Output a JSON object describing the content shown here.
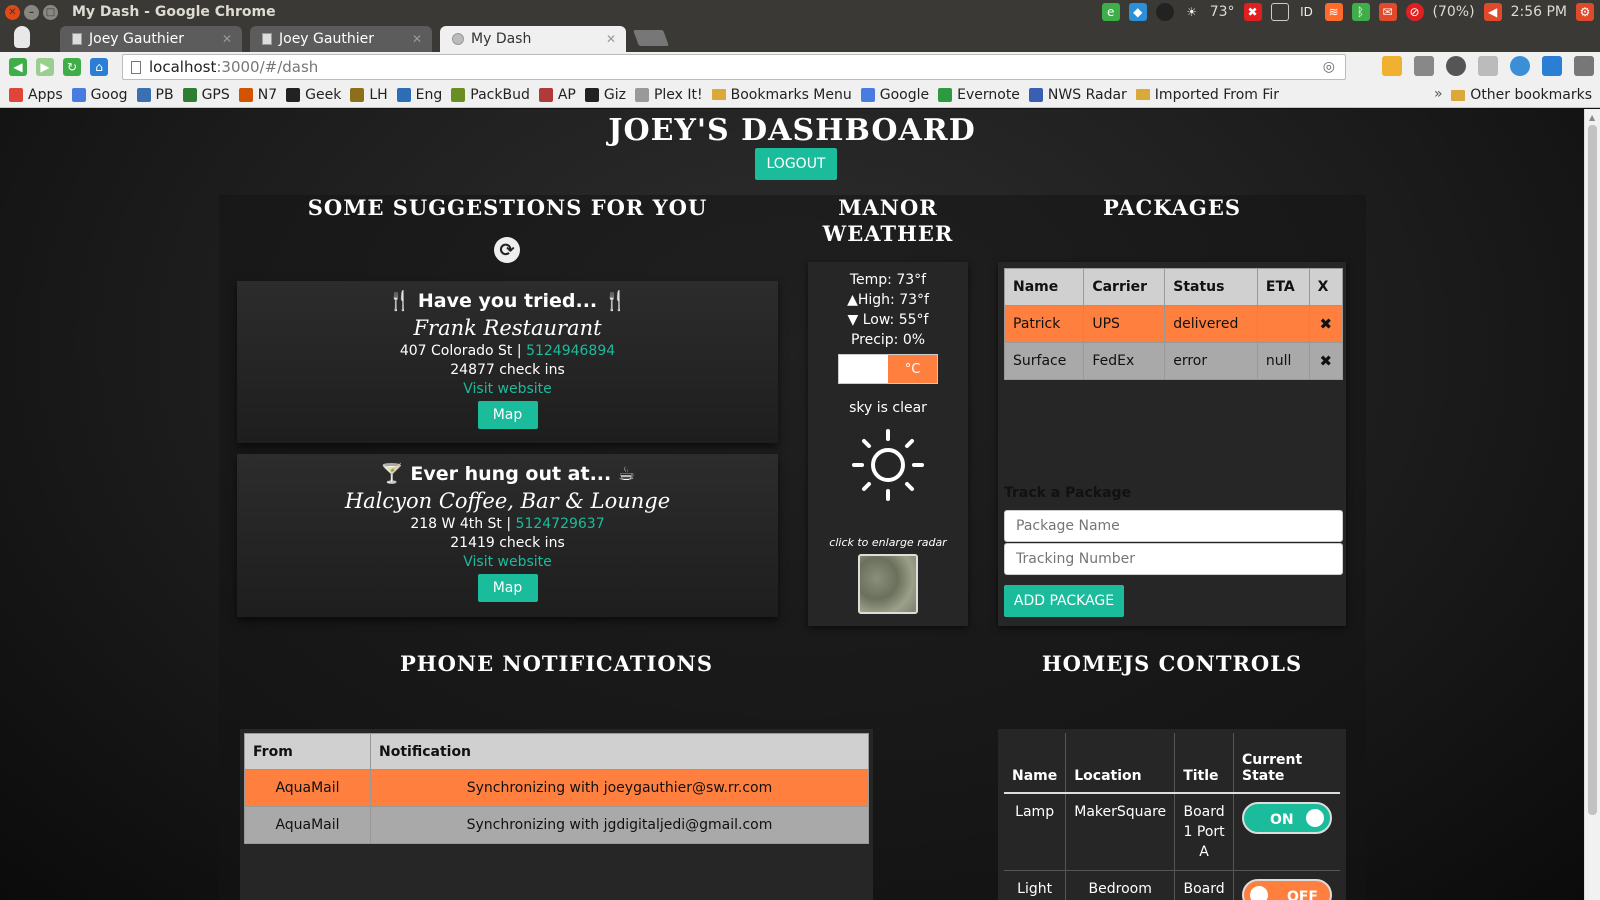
{
  "os_panel": {
    "window_title": "My Dash - Google Chrome",
    "temperature": "73°",
    "battery": "(70%)",
    "clock": "2:56 PM"
  },
  "browser": {
    "tabs": [
      {
        "label": "Joey Gauthier",
        "active": false
      },
      {
        "label": "Joey Gauthier",
        "active": false
      },
      {
        "label": "My Dash",
        "active": true
      }
    ],
    "url_host": "localhost",
    "url_path": ":3000/#/dash",
    "bookmarks": [
      {
        "label": "Apps",
        "icon": "apps-grid-icon",
        "color": "#e0453a"
      },
      {
        "label": "Goog",
        "icon": "google-icon",
        "color": "#4a7be0"
      },
      {
        "label": "PB",
        "icon": "pb-icon",
        "color": "#3a6fb0"
      },
      {
        "label": "GPS",
        "icon": "play-icon",
        "color": "#2e7d32"
      },
      {
        "label": "N7",
        "icon": "n7-icon",
        "color": "#d35400"
      },
      {
        "label": "Geek",
        "icon": "geek-icon",
        "color": "#222222"
      },
      {
        "label": "LH",
        "icon": "lh-icon",
        "color": "#8d6e1a"
      },
      {
        "label": "Eng",
        "icon": "rss-icon",
        "color": "#2c6db5"
      },
      {
        "label": "PackBud",
        "icon": "android-icon",
        "color": "#6b8e23"
      },
      {
        "label": "AP",
        "icon": "ap-flag-icon",
        "color": "#b03a3a"
      },
      {
        "label": "Giz",
        "icon": "giz-icon",
        "color": "#222222"
      },
      {
        "label": "Plex It!",
        "icon": "page-icon",
        "color": "#999999"
      },
      {
        "label": "Bookmarks Menu",
        "icon": "folder-icon",
        "color": "#d9a93c"
      },
      {
        "label": "Google",
        "icon": "google-icon",
        "color": "#4a7be0"
      },
      {
        "label": "Evernote",
        "icon": "evernote-icon",
        "color": "#2e9a3f"
      },
      {
        "label": "NWS Radar",
        "icon": "nws-icon",
        "color": "#3a5fb0"
      },
      {
        "label": "Imported From Fir",
        "icon": "folder-icon",
        "color": "#d9a93c"
      }
    ],
    "other_bookmarks": "Other bookmarks",
    "chevron": "»"
  },
  "page": {
    "title": "JOEY'S DASHBOARD",
    "logout_label": "LOGOUT"
  },
  "suggestions": {
    "title": "SOME SUGGESTIONS FOR YOU",
    "cards": [
      {
        "heading": "Have you tried...",
        "name": "Frank Restaurant",
        "address": "407 Colorado St",
        "phone": "5124946894",
        "checkins": "24877 check ins",
        "website_label": "Visit website",
        "map_label": "Map"
      },
      {
        "heading": "Ever hung out at...",
        "name": "Halcyon Coffee, Bar & Lounge",
        "address": "218 W 4th St",
        "phone": "5124729637",
        "checkins": "21419 check ins",
        "website_label": "Visit website",
        "map_label": "Map"
      }
    ]
  },
  "weather": {
    "title_line1": "MANOR",
    "title_line2": "WEATHER",
    "temp": "Temp: 73°f",
    "high": "High: 73°f",
    "low": "Low: 55°f",
    "precip": "Precip: 0%",
    "unit_label": "°C",
    "sky": "sky is clear",
    "radar_caption": "click to enlarge radar"
  },
  "packages": {
    "title": "PACKAGES",
    "columns": [
      "Name",
      "Carrier",
      "Status",
      "ETA",
      "X"
    ],
    "rows": [
      {
        "name": "Patrick",
        "carrier": "UPS",
        "status": "delivered",
        "eta": "",
        "highlight": true
      },
      {
        "name": "Surface",
        "carrier": "FedEx",
        "status": "error",
        "eta": "null",
        "highlight": false
      }
    ],
    "delete_glyph": "✖",
    "track_label": "Track a Package",
    "name_placeholder": "Package Name",
    "tracking_placeholder": "Tracking Number",
    "add_label": "ADD PACKAGE"
  },
  "notifications": {
    "title": "PHONE NOTIFICATIONS",
    "columns": [
      "From",
      "Notification"
    ],
    "rows": [
      {
        "from": "AquaMail",
        "text": "Synchronizing with joeygauthier@sw.rr.com",
        "highlight": true
      },
      {
        "from": "AquaMail",
        "text": "Synchronizing with jgdigitaljedi@gmail.com",
        "highlight": false
      }
    ]
  },
  "homejs": {
    "title": "HOMEJS CONTROLS",
    "columns": [
      "Name",
      "Location",
      "Title",
      "Current State"
    ],
    "rows": [
      {
        "name": "Lamp",
        "location": "MakerSquare",
        "title": "Board 1 Port A",
        "state": "ON"
      },
      {
        "name": "Light",
        "location": "Bedroom",
        "title": "Board",
        "state": "OFF"
      }
    ]
  },
  "colors": {
    "accent_teal": "#1abc9c",
    "highlight_orange": "#ff7f3f"
  }
}
